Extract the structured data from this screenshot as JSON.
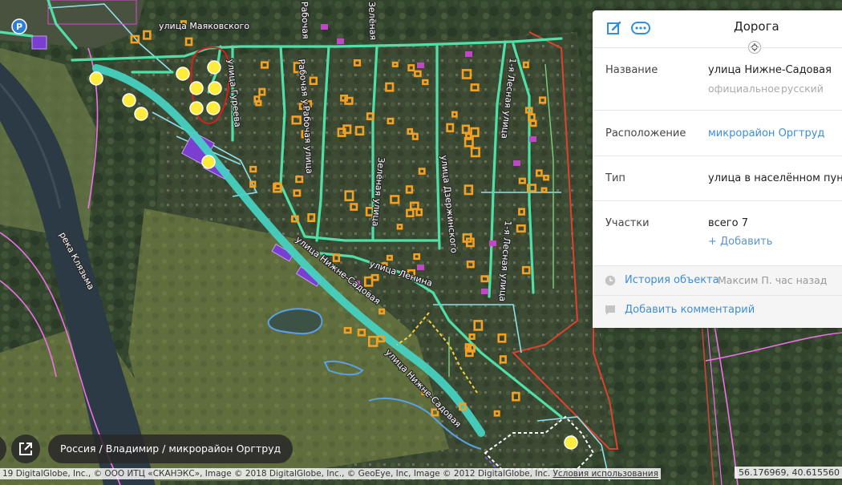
{
  "map": {
    "labels": {
      "mayakovskogo": "улица Маяковского",
      "gureeva": "улица Гуреева",
      "rabochaya_1": "Рабочая улица",
      "rabochaya_2": "Рабочая улица",
      "rabochaya_3": "Рабочая",
      "zelenaya": "Зелёная улица",
      "zelenaya_top": "Зелёная",
      "dzerzhinskogo": "улица Дзержинского",
      "lesnaya_top": "1-я Лесная улица",
      "lesnaya_bottom": "1-я Лесная улица",
      "lenina": "улица Ленина",
      "nizhne_sadovaya_1": "улица Нижне-Садовая",
      "nizhne_sadovaya_2": "улица Нижне-Садовая",
      "river": "река Клязьма"
    },
    "parking_label": "P"
  },
  "panel": {
    "title": "Дорога",
    "edit_icon": "edit-icon",
    "more_icon": "more-icon",
    "rows": {
      "name": {
        "label": "Название",
        "value": "улица Нижне-Садовая",
        "tag_official": "официальное",
        "tag_lang": "русский"
      },
      "location": {
        "label": "Расположение",
        "value": "микрорайон Оргтруд"
      },
      "type": {
        "label": "Тип",
        "value": "улица в населённом пункте"
      },
      "parcels": {
        "label": "Участки",
        "value": "всего 7",
        "add": "+ Добавить"
      }
    },
    "history": {
      "link": "История объекта",
      "meta": "Максим П. час назад"
    },
    "comment": {
      "link": "Добавить комментарий"
    }
  },
  "footer": {
    "breadcrumb": "Россия / Владимир / микрорайон Оргтруд",
    "copyright": "19 DigitalGlobe, Inc., © ООО ИТЦ «СКАНЭКС», Image © 2018 DigitalGlobe, Inc., © GeoEye, Inc, Image © 2012 DigitalGlobe, Inc.",
    "terms": "Условия использования",
    "coords": "56.176969, 40.615560"
  },
  "colors": {
    "road_main": "#4fe0a8",
    "road_selected": "#45d4c4",
    "boundary_pink": "#f070e8",
    "boundary_red": "#e0412f",
    "building_orange": "#f5a020",
    "poi_yellow": "#ffec3a",
    "link_blue": "#3d8ed8"
  }
}
